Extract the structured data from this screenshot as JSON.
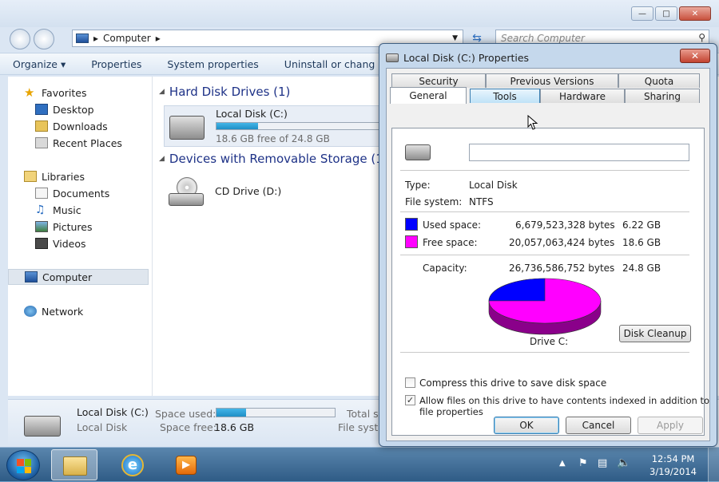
{
  "explorer": {
    "address": {
      "crumb": "Computer",
      "placeholder_search": "Search Computer"
    },
    "toolbar": [
      "Organize ▾",
      "Properties",
      "System properties",
      "Uninstall or chang"
    ],
    "sidebar": {
      "favorites": "Favorites",
      "desktop": "Desktop",
      "downloads": "Downloads",
      "recent": "Recent Places",
      "libraries": "Libraries",
      "documents": "Documents",
      "music": "Music",
      "pictures": "Pictures",
      "videos": "Videos",
      "computer": "Computer",
      "network": "Network"
    },
    "groups": {
      "hdd": "Hard Disk Drives (1)",
      "removable": "Devices with Removable Storage (1"
    },
    "local_disk": {
      "name": "Local Disk (C:)",
      "free": "18.6 GB free of 24.8 GB",
      "used_fraction": 0.25
    },
    "cd_drive": {
      "name": "CD Drive (D:)"
    },
    "details": {
      "name": "Local Disk (C:)",
      "type": "Local Disk",
      "used_label": "Space used:",
      "free_label": "Space free:",
      "free_value": "18.6 GB",
      "total_label": "Total s",
      "fs_label": "File syste",
      "used_fraction": 0.25
    }
  },
  "taskbar": {
    "time": "12:54 PM",
    "date": "3/19/2014"
  },
  "dialog": {
    "title": "Local Disk (C:) Properties",
    "close": "✕",
    "tabs_top": [
      "Security",
      "Previous Versions",
      "Quota"
    ],
    "tabs_bottom": [
      "General",
      "Tools",
      "Hardware",
      "Sharing"
    ],
    "type_label": "Type:",
    "type_value": "Local Disk",
    "fs_label": "File system:",
    "fs_value": "NTFS",
    "used_label": "Used space:",
    "used_bytes": "6,679,523,328 bytes",
    "used_gb": "6.22 GB",
    "free_label": "Free space:",
    "free_bytes": "20,057,063,424 bytes",
    "free_gb": "18.6 GB",
    "capacity_label": "Capacity:",
    "capacity_bytes": "26,736,586,752 bytes",
    "capacity_gb": "24.8 GB",
    "drive_label": "Drive C:",
    "cleanup": "Disk Cleanup",
    "compress": "Compress this drive to save disk space",
    "index_line1": "Allow files on this drive to have contents indexed in addition to",
    "index_line2": "file properties",
    "compress_checked": false,
    "index_checked": true,
    "ok": "OK",
    "cancel": "Cancel",
    "apply": "Apply",
    "colors": {
      "used": "#0000ff",
      "free": "#ff00ff",
      "used_side": "#00008a",
      "free_side": "#8a008a"
    },
    "pie": {
      "used": 6679523328,
      "free": 20057063424
    }
  }
}
